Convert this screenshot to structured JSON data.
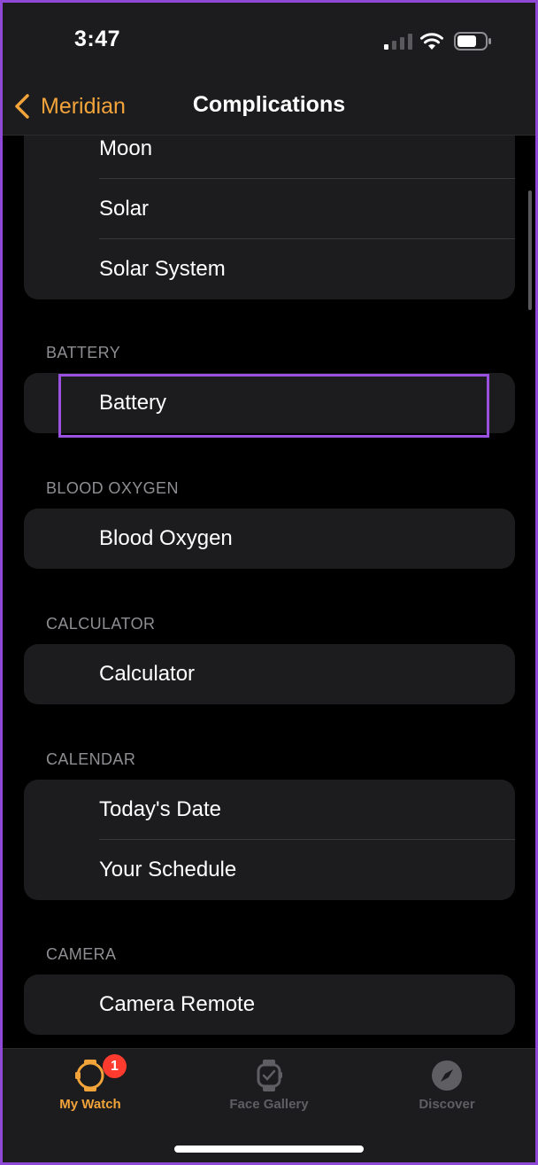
{
  "status_bar": {
    "time": "3:47"
  },
  "nav": {
    "back_label": "Meridian",
    "title": "Complications"
  },
  "sections": [
    {
      "header": "",
      "items": [
        "Moon",
        "Solar",
        "Solar System"
      ]
    },
    {
      "header": "BATTERY",
      "items": [
        "Battery"
      ]
    },
    {
      "header": "BLOOD OXYGEN",
      "items": [
        "Blood Oxygen"
      ]
    },
    {
      "header": "CALCULATOR",
      "items": [
        "Calculator"
      ]
    },
    {
      "header": "CALENDAR",
      "items": [
        "Today's Date",
        "Your Schedule"
      ]
    },
    {
      "header": "CAMERA",
      "items": [
        "Camera Remote"
      ]
    }
  ],
  "tabbar": {
    "tabs": [
      {
        "label": "My Watch",
        "icon": "watch-icon",
        "badge": "1",
        "active": true
      },
      {
        "label": "Face Gallery",
        "icon": "face-gallery-icon",
        "active": false
      },
      {
        "label": "Discover",
        "icon": "compass-icon",
        "active": false
      }
    ]
  },
  "colors": {
    "accent": "#f2a33a",
    "background": "#000000",
    "card": "#1c1c1e",
    "highlight": "#9b51e0",
    "badge": "#ff3b30"
  }
}
